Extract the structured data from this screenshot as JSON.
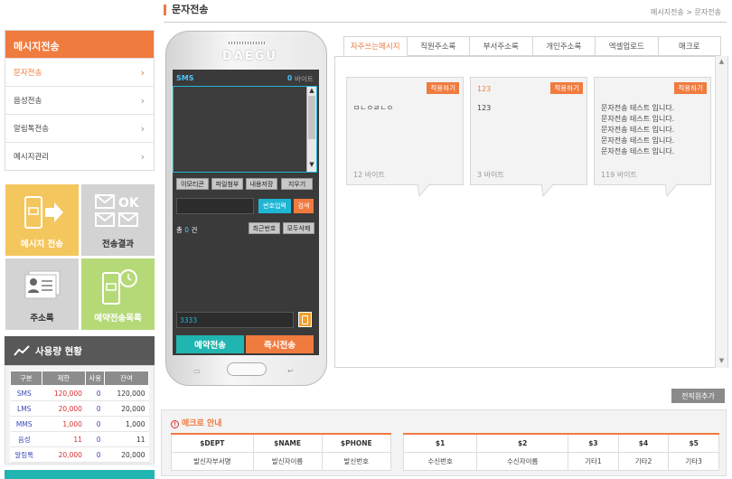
{
  "header": {
    "title": "문자전송",
    "breadcrumb": "메시지전송 > 문자전송"
  },
  "nav": {
    "head": "메시지전송",
    "items": [
      {
        "label": "문자전송"
      },
      {
        "label": "음성전송"
      },
      {
        "label": "알림톡전송"
      },
      {
        "label": "메시지관리"
      }
    ]
  },
  "tiles": {
    "send": "메시지 전송",
    "result": "전송결과",
    "address": "주소록",
    "reserved": "예약전송목록"
  },
  "usage": {
    "title": "사용량 현황",
    "cols": [
      "구분",
      "제한",
      "사용",
      "잔여"
    ],
    "rows": [
      {
        "type": "SMS",
        "limit": "120,000",
        "used": "0",
        "left": "120,000"
      },
      {
        "type": "LMS",
        "limit": "20,000",
        "used": "0",
        "left": "20,000"
      },
      {
        "type": "MMS",
        "limit": "1,000",
        "used": "0",
        "left": "1,000"
      },
      {
        "type": "음성",
        "limit": "11",
        "used": "0",
        "left": "11"
      },
      {
        "type": "알림톡",
        "limit": "20,000",
        "used": "0",
        "left": "20,000"
      }
    ]
  },
  "phone": {
    "brand": "DAEGU",
    "msg_type": "SMS",
    "bytes": "0",
    "bytes_unit": "바이트",
    "btn_emoticon": "이모티콘",
    "btn_attach": "파일첨부",
    "btn_save": "내용저장",
    "btn_clear": "지우기",
    "btn_input_number": "번호입력",
    "btn_search": "검색",
    "count_prefix": "총",
    "count": "0",
    "count_suffix": "건",
    "btn_recent": "최근번호",
    "btn_delete_all": "모두삭제",
    "sender_number": "3333",
    "btn_reserve": "예약전송",
    "btn_send_now": "즉시전송"
  },
  "tabs": [
    {
      "label": "자주쓰는메시지"
    },
    {
      "label": "직원주소록"
    },
    {
      "label": "부서주소록"
    },
    {
      "label": "개인주소록"
    },
    {
      "label": "엑셀업로드"
    },
    {
      "label": "매크로"
    }
  ],
  "cards": [
    {
      "title": "",
      "body": "ㅁㄴㅇㄹㄴㅇ",
      "bytes": "12 바이트",
      "apply": "적용하기"
    },
    {
      "title": "123",
      "body": "123",
      "bytes": "3 바이트",
      "apply": "적용하기"
    },
    {
      "title": "",
      "body": "문자전송 테스트 입니다.\n문자전송 테스트 입니다.\n문자전송 테스트 입니다.\n문자전송 테스트 입니다.\n문자전송 테스트 입니다.",
      "bytes": "119 바이트",
      "apply": "적용하기"
    }
  ],
  "add_button": "전직원추가",
  "macro": {
    "title": "매크로 안내",
    "left": {
      "headers": [
        "$DEPT",
        "$NAME",
        "$PHONE"
      ],
      "values": [
        "발신자부서명",
        "발신자이름",
        "발신번호"
      ]
    },
    "right": {
      "headers": [
        "$1",
        "$2",
        "$3",
        "$4",
        "$5"
      ],
      "values": [
        "수신번호",
        "수신자이름",
        "기타1",
        "기타2",
        "기타3"
      ]
    }
  },
  "colors": {
    "accent": "#f07b3f",
    "teal": "#20b5b0",
    "tile_yellow": "#f4c65e",
    "tile_green": "#b5d977",
    "tile_gray": "#d3d3d3"
  }
}
